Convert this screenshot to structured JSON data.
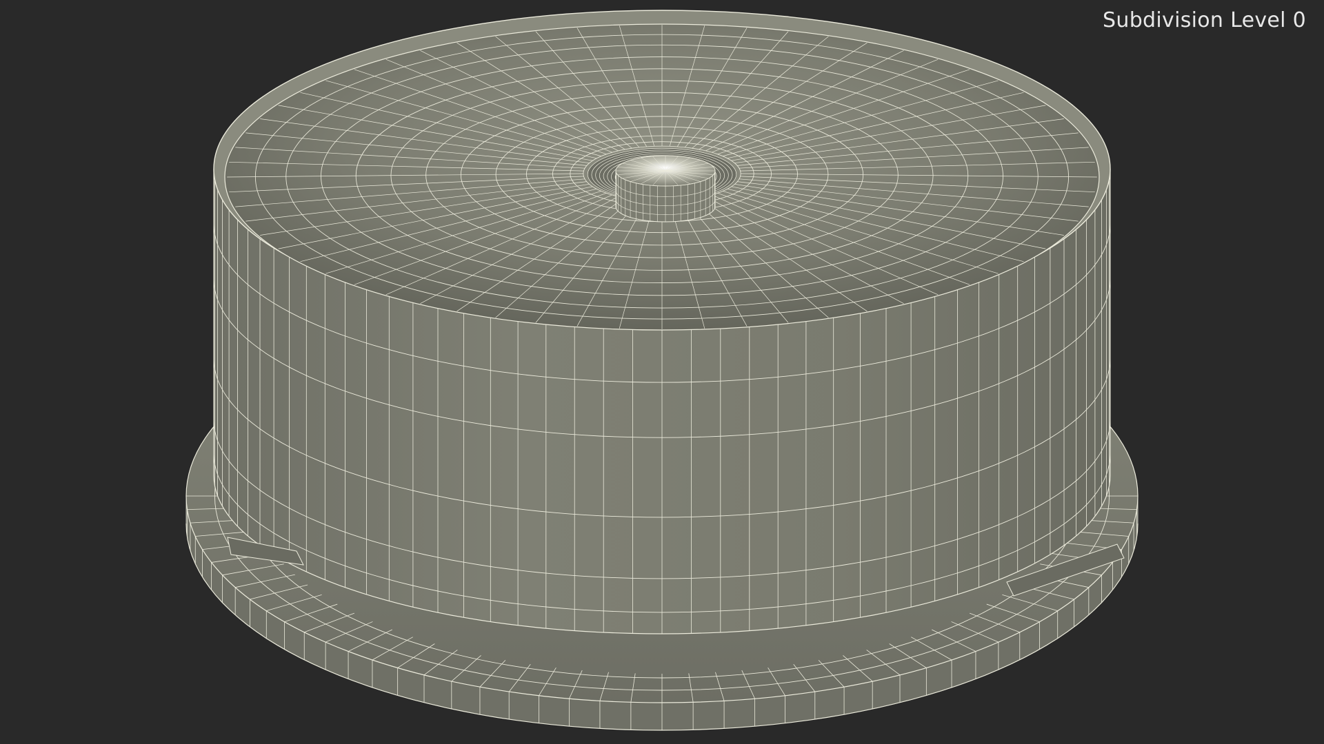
{
  "overlay": {
    "subdivision_label": "Subdivision Level 0"
  },
  "render": {
    "background_color": "#292929",
    "surface_color": "#7d7e72",
    "surface_dark_color": "#5e5f55",
    "surface_light_color": "#9a9b8e",
    "wire_color": "#ecebdc",
    "subject": "CD spindle container base (wireframe render)"
  }
}
